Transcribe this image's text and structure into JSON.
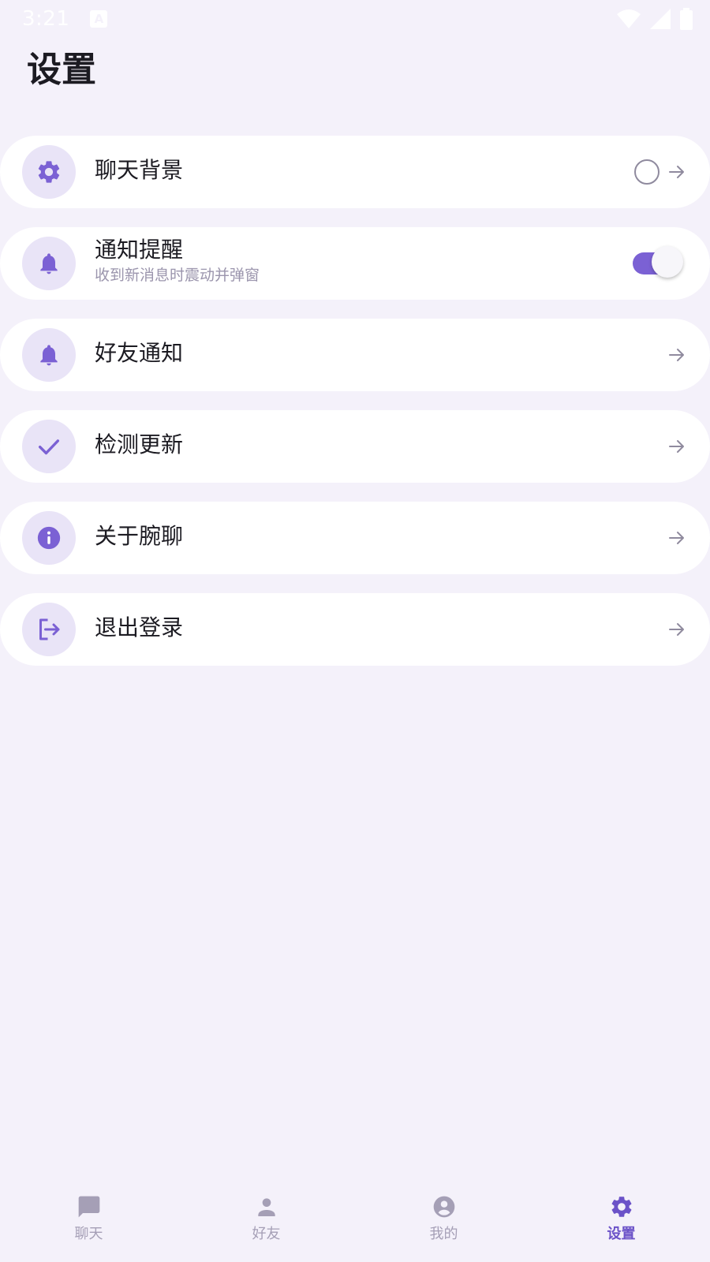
{
  "status_bar": {
    "time": "3:21",
    "indicator": "A",
    "icons": [
      "wifi-icon",
      "signal-icon",
      "battery-icon"
    ]
  },
  "page": {
    "title": "设置"
  },
  "settings": [
    {
      "label": "聊天背景",
      "icon": "gear-icon",
      "trailing": "radio-and-arrow"
    },
    {
      "label": "通知提醒",
      "subtitle": "收到新消息时震动并弹窗",
      "icon": "bell-icon",
      "trailing": "toggle",
      "toggle_on": true
    },
    {
      "label": "好友通知",
      "icon": "bell-icon",
      "trailing": "arrow"
    },
    {
      "label": "检测更新",
      "icon": "check-icon",
      "trailing": "arrow"
    },
    {
      "label": "关于腕聊",
      "icon": "info-icon",
      "trailing": "arrow"
    },
    {
      "label": "退出登录",
      "icon": "logout-icon",
      "trailing": "arrow"
    }
  ],
  "bottom_nav": [
    {
      "label": "聊天",
      "icon": "chat-icon",
      "active": false
    },
    {
      "label": "好友",
      "icon": "person-icon",
      "active": false
    },
    {
      "label": "我的",
      "icon": "account-circle-icon",
      "active": false
    },
    {
      "label": "设置",
      "icon": "gear-icon",
      "active": true
    }
  ],
  "colors": {
    "background": "#f4f1fa",
    "accent": "#7b61d4",
    "icon_bg": "#e9e4f7",
    "nav_inactive": "#a59fb6",
    "nav_active": "#6b52c8"
  }
}
